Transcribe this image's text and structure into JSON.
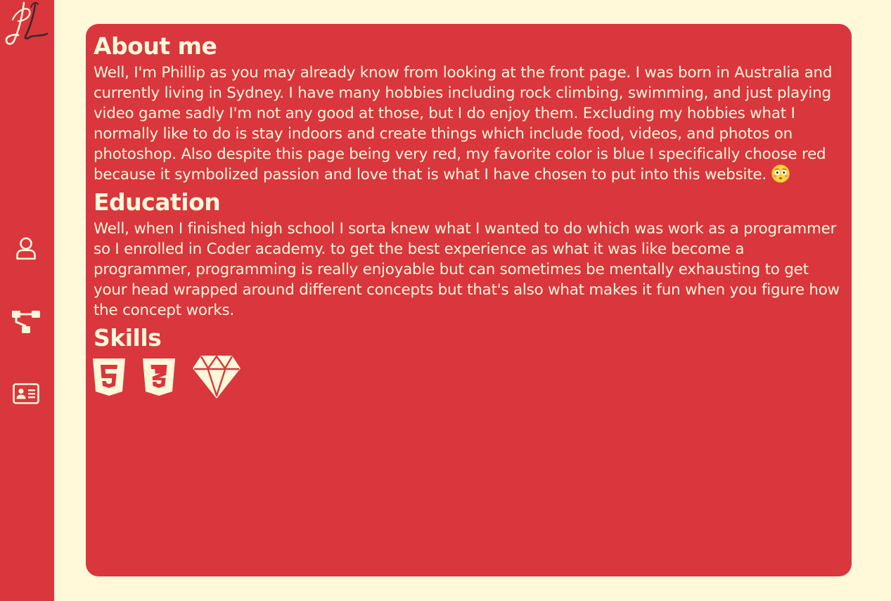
{
  "sidebar": {
    "logo_text": "PL",
    "nav": [
      {
        "icon": "user-icon"
      },
      {
        "icon": "sitemap-icon"
      },
      {
        "icon": "id-card-icon"
      }
    ]
  },
  "about": {
    "heading": "About me",
    "body": "Well, I'm Phillip as you may already know from looking at the front page. I was born in Australia and currently living in Sydney. I have many hobbies including rock climbing, swimming, and just playing video game sadly I'm not any good at those, but I do enjoy them. Excluding my hobbies what I normally like to do is stay indoors and create things which include food, videos, and photos on photoshop. Also despite this page being very red, my favorite color is blue I specifically choose red because it symbolized passion and love that is what I have chosen to put into this website.",
    "emoji": "flushed-face-emoji"
  },
  "education": {
    "heading": "Education",
    "body": "Well, when I finished high school I sorta knew what I wanted to do which was work as a programmer so I enrolled in Coder academy. to get the best experience as what it was like become a programmer, programming is really enjoyable but can sometimes be mentally exhausting to get your head wrapped around different concepts but that's also what makes it fun when you figure how the concept works."
  },
  "skills": {
    "heading": "Skills",
    "icons": [
      "html5-icon",
      "css3-icon",
      "ruby-gem-icon"
    ]
  },
  "colors": {
    "background": "#fff8d9",
    "accent": "#d9363e",
    "text": "#fff8d9"
  }
}
